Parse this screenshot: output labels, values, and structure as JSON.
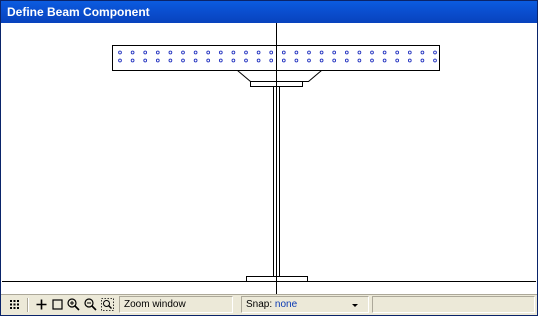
{
  "window": {
    "title": "Define Beam Component"
  },
  "toolbar": {
    "buttons": [
      {
        "name": "grid-icon"
      },
      {
        "name": "pan-icon"
      },
      {
        "name": "select-box-icon"
      },
      {
        "name": "zoom-in-icon"
      },
      {
        "name": "zoom-out-icon"
      },
      {
        "name": "zoom-window-icon"
      }
    ]
  },
  "status": {
    "mode_text": "Zoom window",
    "snap_label": "Snap: ",
    "snap_value": "none"
  },
  "colors": {
    "title_bar": "#0a4fd0",
    "status_bar": "#ece9d8",
    "stud_dots": "#1f2fbf",
    "beam_lines": "#000000"
  }
}
